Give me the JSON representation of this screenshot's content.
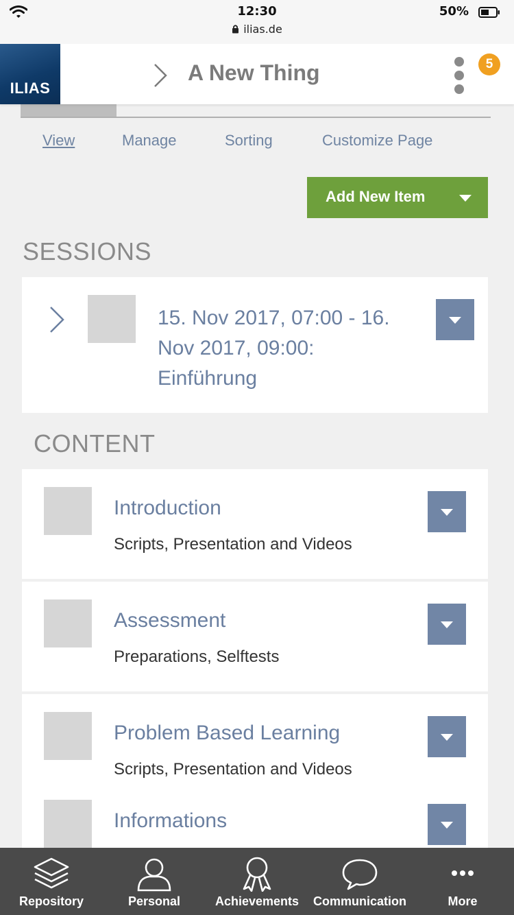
{
  "status_bar": {
    "time": "12:30",
    "url": "ilias.de",
    "battery": "50%"
  },
  "header": {
    "logo_text": "ILIAS",
    "title": "A New Thing",
    "badge_count": "5"
  },
  "subtabs": [
    {
      "label": "View",
      "active": true
    },
    {
      "label": "Manage",
      "active": false
    },
    {
      "label": "Sorting",
      "active": false
    },
    {
      "label": "Customize Page",
      "active": false
    }
  ],
  "add_button": {
    "label": "Add New Item"
  },
  "sessions": {
    "heading": "SESSIONS",
    "items": [
      {
        "title_line1": "15. Nov 2017, 07:00 - 16.",
        "title_line2": "Nov 2017, 09:00:",
        "title_line3": "Einführung"
      }
    ]
  },
  "content": {
    "heading": "CONTENT",
    "items": [
      {
        "title": "Introduction",
        "description": "Scripts, Presentation and Videos"
      },
      {
        "title": "Assessment",
        "description": "Preparations, Selftests"
      },
      {
        "title": "Problem Based Learning",
        "description": "Scripts, Presentation and Videos"
      },
      {
        "title": "Informations",
        "description": ""
      }
    ]
  },
  "bottom_nav": [
    {
      "label": "Repository",
      "icon": "layers-icon"
    },
    {
      "label": "Personal",
      "icon": "person-icon"
    },
    {
      "label": "Achievements",
      "icon": "award-icon"
    },
    {
      "label": "Communication",
      "icon": "chat-bubble-icon"
    },
    {
      "label": "More",
      "icon": "more-dots-icon"
    }
  ],
  "colors": {
    "accent_green": "#6ea03c",
    "link_blue": "#6a7fa0",
    "dropdown_blue": "#7186a6",
    "badge_orange": "#f0a021",
    "nav_bg": "#4a4a4a"
  }
}
